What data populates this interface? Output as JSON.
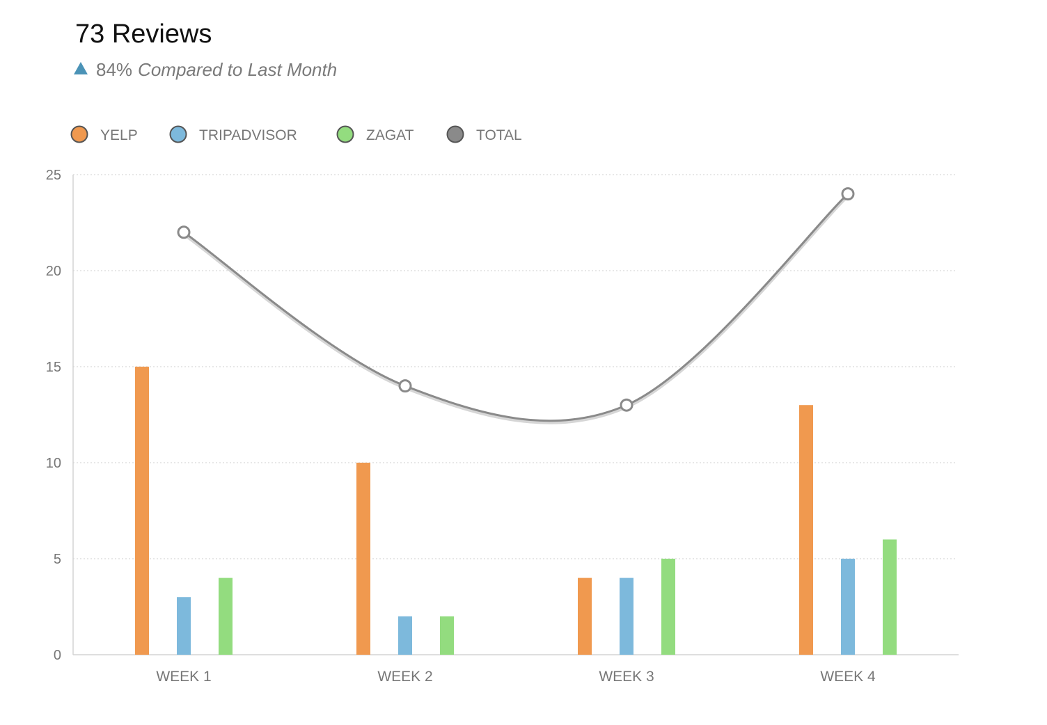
{
  "header": {
    "title": "73 Reviews",
    "change_percent": "84%",
    "change_text": "Compared to Last Month",
    "trend_icon": "triangle-up-icon",
    "trend_color": "#4b93b7"
  },
  "chart_data": {
    "type": "bar",
    "categories": [
      "WEEK 1",
      "WEEK 2",
      "WEEK 3",
      "WEEK 4"
    ],
    "series": [
      {
        "name": "YELP",
        "type": "bar",
        "color": "#f0994f",
        "values": [
          15,
          10,
          4,
          13
        ]
      },
      {
        "name": "TRIPADVISOR",
        "type": "bar",
        "color": "#7db9dc",
        "values": [
          3,
          2,
          4,
          5
        ]
      },
      {
        "name": "ZAGAT",
        "type": "bar",
        "color": "#93dc7f",
        "values": [
          4,
          2,
          5,
          6
        ]
      },
      {
        "name": "TOTAL",
        "type": "line",
        "color": "#8a8a8a",
        "values": [
          22,
          14,
          13,
          24
        ]
      }
    ],
    "ylim": [
      0,
      25
    ],
    "yticks": [
      0,
      5,
      10,
      15,
      20,
      25
    ],
    "grid": true,
    "legend_position": "top-left",
    "xlabel": "",
    "ylabel": ""
  }
}
